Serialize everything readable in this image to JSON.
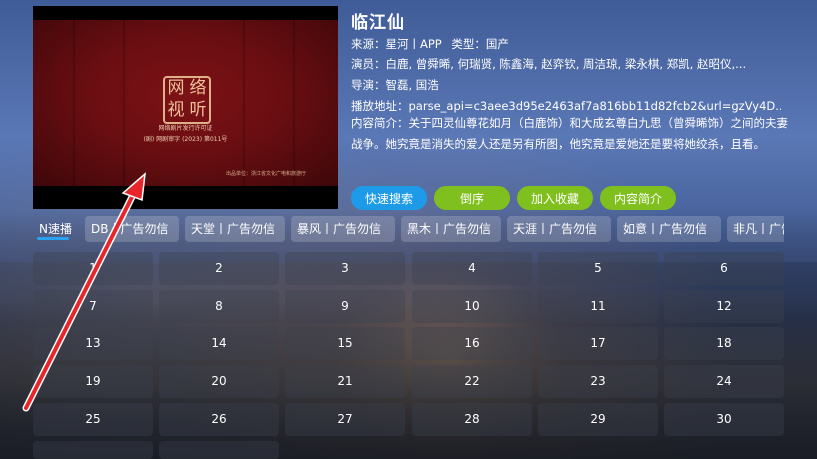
{
  "player": {
    "seal_chars": [
      "网",
      "络",
      "视",
      "听"
    ],
    "license_line1": "网络剧片发行许可证",
    "license_line2": "(剧) 网剧审字 (2023) 第011号",
    "studio_line": "出品单位：浙江省文化广电和旅游厅"
  },
  "details": {
    "title": "临江仙",
    "source_label": "来源：",
    "source_value": "星河丨APP",
    "type_label": "类型：",
    "type_value": "国产",
    "cast_label": "演员：",
    "cast_value": "白鹿, 曾舜晞, 何瑞贤, 陈鑫海, 赵弈钦, 周洁琼, 梁永棋, 郑凯, 赵昭仪,...",
    "director_label": "导演：",
    "director_value": "智磊, 国浩",
    "url_label": "播放地址：",
    "url_value": "parse_api=c3aee3d95e2463af7a816bb11d82fcb2&url=gzVy4D...",
    "desc_label": "内容简介：",
    "desc_value": "关于四灵仙尊花如月（白鹿饰）和大成玄尊白九思（曾舜晞饰）之间的夫妻战争。她究竟是消失的爱人还是另有所图，他究竟是爱她还是要将她绞杀，且看。"
  },
  "buttons": {
    "quick_search": "快速搜索",
    "reverse": "倒序",
    "add_favorite": "加入收藏",
    "synopsis": "内容简介"
  },
  "sources": [
    "N速播",
    "DB丨广告勿信",
    "天堂丨广告勿信",
    "暴风丨广告勿信",
    "黑木丨广告勿信",
    "天涯丨广告勿信",
    "如意丨广告勿信",
    "非凡丨广告勿信"
  ],
  "episodes": [
    "1",
    "2",
    "3",
    "4",
    "5",
    "6",
    "7",
    "8",
    "9",
    "10",
    "11",
    "12",
    "13",
    "14",
    "15",
    "16",
    "17",
    "18",
    "19",
    "20",
    "21",
    "22",
    "23",
    "24",
    "25",
    "26",
    "27",
    "28",
    "29",
    "30"
  ],
  "colors": {
    "accent_blue": "#1e9be8",
    "accent_green": "#7fbf1e"
  }
}
